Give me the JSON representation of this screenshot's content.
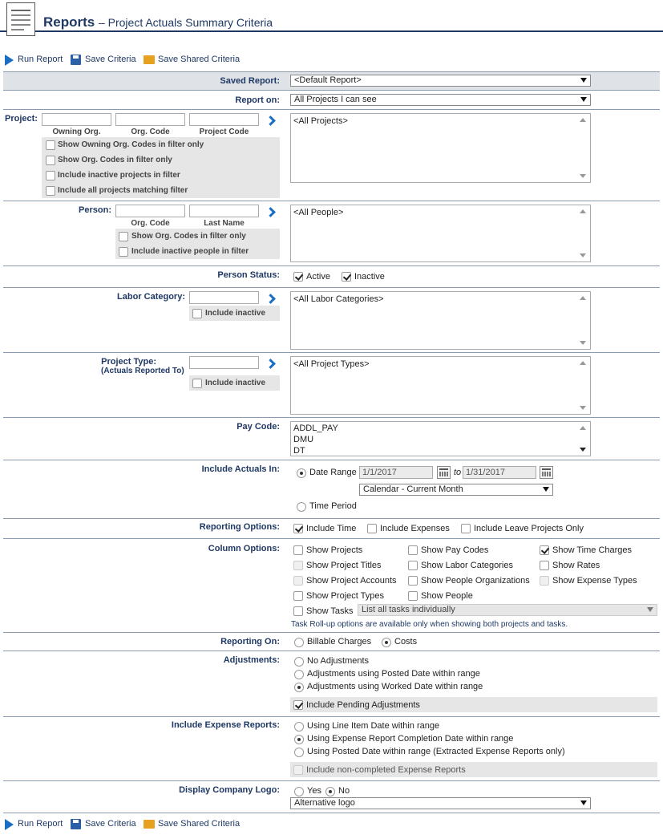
{
  "header": {
    "title": "Reports",
    "subtitle": "– Project Actuals Summary Criteria"
  },
  "toolbar": {
    "run_report": "Run Report",
    "save_criteria": "Save Criteria",
    "save_shared": "Save Shared Criteria"
  },
  "saved_report": {
    "label": "Saved Report:",
    "value": "<Default Report>"
  },
  "report_on": {
    "label": "Report on:",
    "value": "All Projects I can see"
  },
  "project": {
    "label": "Project:",
    "col1": "Owning Org.",
    "col2": "Org. Code",
    "col3": "Project Code",
    "opt1": "Show Owning Org. Codes in filter only",
    "opt2": "Show Org. Codes in filter only",
    "opt3": "Include inactive projects in filter",
    "opt4": "Include all projects matching filter",
    "list": "<All Projects>"
  },
  "person": {
    "label": "Person:",
    "col1": "Org. Code",
    "col2": "Last Name",
    "opt1": "Show Org. Codes in filter only",
    "opt2": "Include inactive people in filter",
    "list": "<All People>"
  },
  "person_status": {
    "label": "Person Status:",
    "active": "Active",
    "inactive": "Inactive"
  },
  "labor_category": {
    "label": "Labor Category:",
    "opt": "Include inactive",
    "list": "<All Labor Categories>"
  },
  "project_type": {
    "label": "Project Type:",
    "sublabel": "(Actuals Reported To)",
    "opt": "Include inactive",
    "list": "<All Project Types>"
  },
  "pay_code": {
    "label": "Pay Code:",
    "items": [
      "ADDL_PAY",
      "DMU",
      "DT"
    ]
  },
  "include_actuals": {
    "label": "Include Actuals In:",
    "date_range": "Date Range",
    "from": "1/1/2017",
    "to_label": "to",
    "to": "1/31/2017",
    "period": "Calendar - Current Month",
    "time_period": "Time Period"
  },
  "reporting_options": {
    "label": "Reporting Options:",
    "time": "Include Time",
    "expenses": "Include Expenses",
    "leave": "Include Leave Projects Only"
  },
  "column_options": {
    "label": "Column Options:",
    "show_projects": "Show Projects",
    "show_pay_codes": "Show Pay Codes",
    "show_time_charges": "Show Time Charges",
    "show_project_titles": "Show Project Titles",
    "show_labor_categories": "Show Labor Categories",
    "show_rates": "Show Rates",
    "show_project_accounts": "Show Project Accounts",
    "show_people_orgs": "Show People Organizations",
    "show_expense_types": "Show Expense Types",
    "show_project_types": "Show Project Types",
    "show_people": "Show People",
    "show_tasks": "Show Tasks",
    "tasks_value": "List all tasks individually",
    "note": "Task Roll-up options are available only when showing both projects and tasks."
  },
  "reporting_on": {
    "label": "Reporting On:",
    "billable": "Billable Charges",
    "costs": "Costs"
  },
  "adjustments": {
    "label": "Adjustments:",
    "none": "No Adjustments",
    "posted": "Adjustments using Posted Date within range",
    "worked": "Adjustments using Worked Date within range",
    "pending": "Include Pending Adjustments"
  },
  "expense_reports": {
    "label": "Include Expense Reports:",
    "line_item": "Using Line Item Date within range",
    "completion": "Using Expense Report Completion Date within range",
    "posted": "Using Posted Date within range (Extracted Expense Reports only)",
    "non_completed": "Include non-completed Expense Reports"
  },
  "company_logo": {
    "label": "Display Company Logo:",
    "yes": "Yes",
    "no": "No",
    "logo": "Alternative logo"
  }
}
